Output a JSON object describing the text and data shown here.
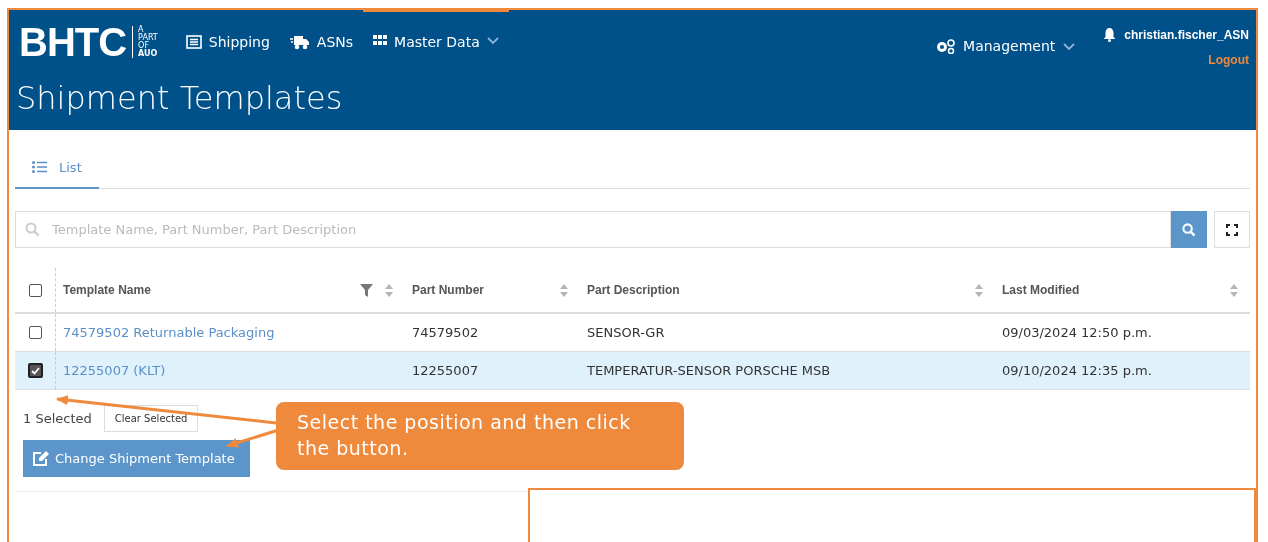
{
  "logo": {
    "name": "BHTC",
    "tagline": [
      "A",
      "PART",
      "OF"
    ],
    "parent": "AUO"
  },
  "nav": [
    {
      "label": "Shipping",
      "kind": "list",
      "dropdown": false,
      "selected": false
    },
    {
      "label": "ASNs",
      "kind": "truck",
      "dropdown": false,
      "selected": false
    },
    {
      "label": "Master Data",
      "kind": "grid",
      "dropdown": true,
      "selected": true
    }
  ],
  "management": {
    "label": "Management"
  },
  "user": {
    "name": "christian.fischer_ASN",
    "logout": "Logout"
  },
  "page_title": "Shipment Templates",
  "tabs": [
    {
      "label": "List",
      "selected": true
    }
  ],
  "search": {
    "placeholder": "Template Name, Part Number, Part Description"
  },
  "table": {
    "select_all_checked": false,
    "columns": [
      {
        "label": "Template Name",
        "filter": true
      },
      {
        "label": "Part Number",
        "filter": false
      },
      {
        "label": "Part Description",
        "filter": false
      },
      {
        "label": "Last Modified",
        "filter": false
      }
    ],
    "rows": [
      {
        "checked": false,
        "selected": false,
        "cells": [
          "74579502 Returnable Packaging",
          "74579502",
          "SENSOR-GR",
          "09/03/2024 12:50 p.m."
        ]
      },
      {
        "checked": true,
        "selected": true,
        "cells": [
          "12255007 (KLT)",
          "12255007",
          "TEMPERATUR-SENSOR PORSCHE MSB",
          "09/10/2024 12:35 p.m."
        ]
      }
    ]
  },
  "selection": {
    "count": "1 Selected",
    "clear": "Clear Selected"
  },
  "action_button": "Change Shipment Template",
  "callout": "Select the position and then click the button."
}
